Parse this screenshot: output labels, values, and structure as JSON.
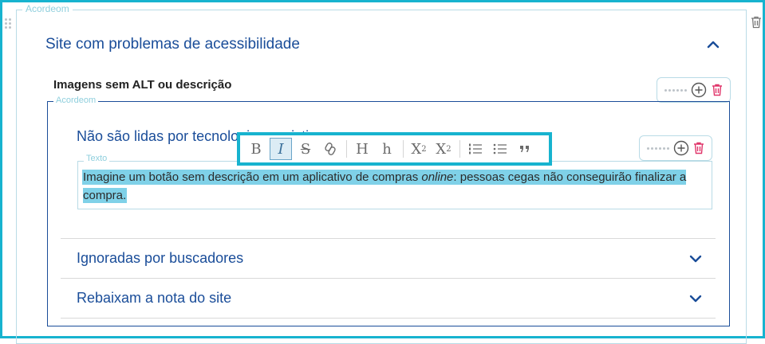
{
  "outer_block": {
    "label": "Acordeom",
    "title": "Site com problemas de acessibilidade",
    "subheading": "Imagens sem ALT ou descrição"
  },
  "inner_block": {
    "label": "Acordeom",
    "items": [
      {
        "title": "Não são lidas por tecnologias assistivas",
        "expanded": true
      },
      {
        "title": "Ignoradas por buscadores",
        "expanded": false
      },
      {
        "title": "Rebaixam a nota do site",
        "expanded": false
      }
    ]
  },
  "text_block": {
    "label": "Texto",
    "content_before": "Imagine um botão sem descrição em um aplicativo de compras ",
    "content_italic": "online",
    "content_after": ": pessoas cegas não conseguirão finalizar a compra."
  },
  "format_toolbar": {
    "bold": "B",
    "italic": "I",
    "strike": "S",
    "heading_large": "H",
    "heading_small": "h",
    "subscript": "X",
    "subscript_mark": "2",
    "superscript": "X",
    "superscript_mark": "2"
  },
  "colors": {
    "accent": "#17b3cf",
    "title_blue": "#1a4d99",
    "highlight": "#7fd1e8",
    "delete_pink": "#e0356a"
  },
  "icons": [
    "drag-handle-icon",
    "add-circle-icon",
    "trash-icon",
    "chevron-up-icon",
    "chevron-down-icon",
    "bold-icon",
    "italic-icon",
    "strikethrough-icon",
    "link-icon",
    "ordered-list-icon",
    "bullet-list-icon",
    "quote-icon"
  ]
}
